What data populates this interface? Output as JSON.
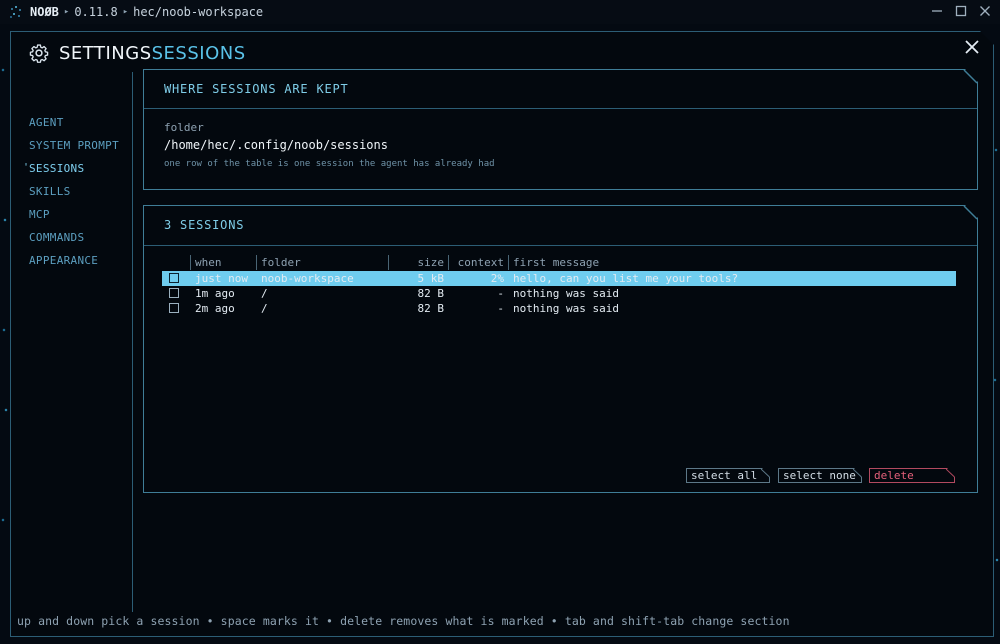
{
  "titlebar": {
    "app_name": "NOØB",
    "version": "0.11.8",
    "workspace": "hec/noob-workspace",
    "separator": "▸"
  },
  "header": {
    "settings_label": "SETTINGS",
    "section_label": "SESSIONS"
  },
  "sidebar": {
    "items": [
      {
        "label": "AGENT",
        "active": false
      },
      {
        "label": "SYSTEM PROMPT",
        "active": false
      },
      {
        "label": "SESSIONS",
        "active": true
      },
      {
        "label": "SKILLS",
        "active": false
      },
      {
        "label": "MCP",
        "active": false
      },
      {
        "label": "COMMANDS",
        "active": false
      },
      {
        "label": "APPEARANCE",
        "active": false
      }
    ]
  },
  "location_card": {
    "title": "WHERE SESSIONS ARE KEPT",
    "folder_label": "folder",
    "folder_value": "/home/hec/.config/noob/sessions",
    "hint": "one row of the table is one session the agent has already had"
  },
  "sessions_card": {
    "title": "3 SESSIONS",
    "columns": [
      "when",
      "folder",
      "size",
      "context",
      "first message"
    ],
    "rows": [
      {
        "when": "just now",
        "folder": "noob-workspace",
        "size": "5 kB",
        "context": "2%",
        "message": "hello, can you list me your tools?",
        "selected": true
      },
      {
        "when": "1m ago",
        "folder": "/",
        "size": "82 B",
        "context": "-",
        "message": "nothing was said",
        "selected": false
      },
      {
        "when": "2m ago",
        "folder": "/",
        "size": "82 B",
        "context": "-",
        "message": "nothing was said",
        "selected": false
      }
    ],
    "buttons": {
      "select_all": "select all",
      "select_none": "select none",
      "delete": "delete"
    }
  },
  "footer_hint": "up and down pick a session • space marks it • delete removes what is marked • tab and shift-tab change section",
  "colors": {
    "accent": "#5ac2e8",
    "selected_row": "#6fcdef",
    "danger": "#e4607a",
    "border": "#3f7d97"
  },
  "icons": {
    "logo": "noob-logo-icon",
    "gear": "gear-icon",
    "close": "close-icon",
    "minimize": "minimize-icon",
    "maximize": "maximize-icon",
    "window_close": "window-close-icon"
  }
}
